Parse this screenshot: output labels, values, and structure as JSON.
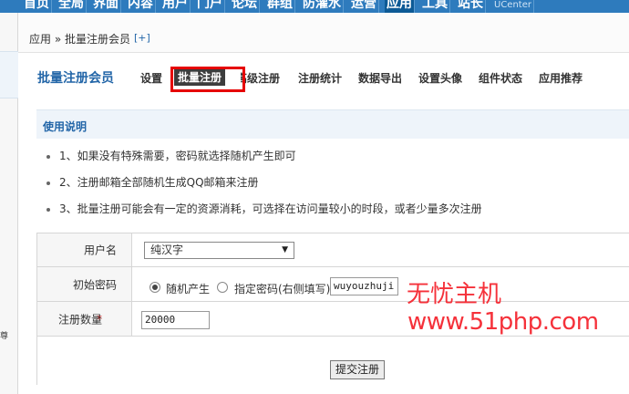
{
  "topnav": {
    "items": [
      {
        "label": "首页",
        "active": false
      },
      {
        "label": "全局",
        "active": false
      },
      {
        "label": "界面",
        "active": false
      },
      {
        "label": "内容",
        "active": false
      },
      {
        "label": "用户",
        "active": false
      },
      {
        "label": "门户",
        "active": false
      },
      {
        "label": "论坛",
        "active": false
      },
      {
        "label": "群组",
        "active": false
      },
      {
        "label": "防灌水",
        "active": false
      },
      {
        "label": "运营",
        "active": false
      },
      {
        "label": "应用",
        "active": true
      },
      {
        "label": "工具",
        "active": false
      },
      {
        "label": "站长",
        "active": false
      },
      {
        "label": "UCenter",
        "active": false
      }
    ]
  },
  "breadcrumb": {
    "text": "应用 » 批量注册会员",
    "plus": "[+]"
  },
  "subnav": {
    "title": "批量注册会员",
    "tabs": [
      {
        "label": "设置",
        "active": false
      },
      {
        "label": "批量注册",
        "active": true
      },
      {
        "label": "高级注册",
        "active": false
      },
      {
        "label": "注册统计",
        "active": false
      },
      {
        "label": "数据导出",
        "active": false
      },
      {
        "label": "设置头像",
        "active": false
      },
      {
        "label": "组件状态",
        "active": false
      },
      {
        "label": "应用推荐",
        "active": false
      }
    ]
  },
  "usage": {
    "header": "使用说明",
    "items": [
      "1、如果没有特殊需要，密码就选择随机产生即可",
      "2、注册邮箱全部随机生成QQ邮箱来注册",
      "3、批量注册可能会有一定的资源消耗，可选择在访问量较小的时段，或者少量多次注册"
    ]
  },
  "form": {
    "username": {
      "label": "用户名",
      "selected": "纯汉字"
    },
    "password": {
      "label": "初始密码",
      "option_random": "随机产生",
      "option_custom": "指定密码(右侧填写)",
      "random_checked": true,
      "custom_value": "wuyouzhuji"
    },
    "count": {
      "required_mark": "*",
      "label": "注册数量",
      "value": "20000"
    },
    "submit_label": "提交注册"
  },
  "watermark": {
    "line1": "无忧主机",
    "line2": "www.51php.com"
  },
  "leftstrip": {
    "glyph": "尊"
  },
  "colors": {
    "topnav": "#2e7bbd",
    "topnav_active": "#0d5a96",
    "link_blue": "#2366a8",
    "highlight_red": "#e60000",
    "watermark_red": "#f5313a"
  }
}
